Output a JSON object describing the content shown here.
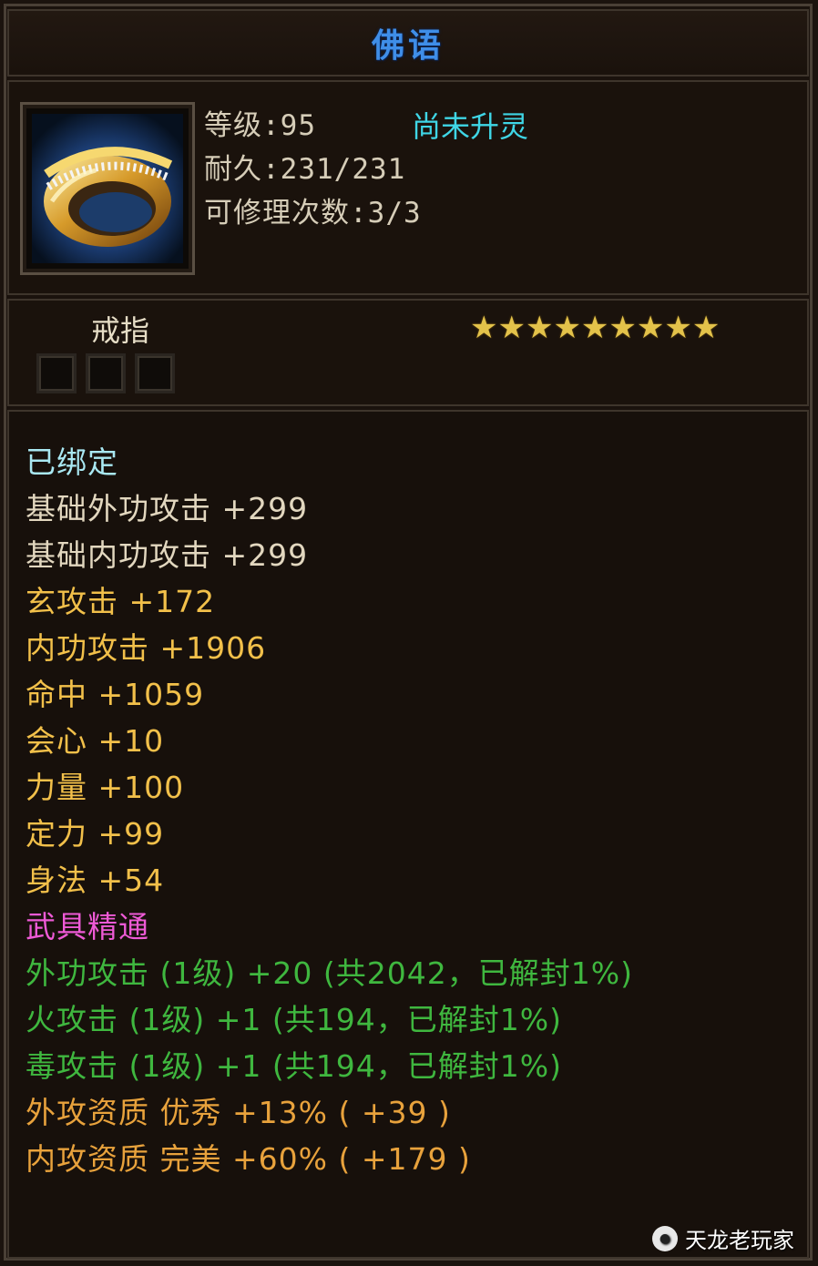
{
  "item": {
    "title": "佛语",
    "level_line": "等级:95",
    "durability_line": "耐久:231/231",
    "repair_line": "可修理次数:3/3",
    "spirit_status": "尚未升灵",
    "type": "戒指",
    "stars_text": "★★★★★★★★★",
    "star_count": 9,
    "socket_count": 3
  },
  "attributes": [
    {
      "text": "已绑定"
    },
    {
      "text": "基础外功攻击 +299"
    },
    {
      "text": "基础内功攻击 +299"
    },
    {
      "text": "玄攻击 +172"
    },
    {
      "text": "内功攻击 +1906"
    },
    {
      "text": "命中 +1059"
    },
    {
      "text": "会心 +10"
    },
    {
      "text": "力量 +100"
    },
    {
      "text": "定力 +99"
    },
    {
      "text": "身法 +54"
    },
    {
      "text": "武具精通"
    },
    {
      "text": "外功攻击 (1级) +20 (共2042，已解封1%)"
    },
    {
      "text": "火攻击 (1级) +1 (共194，已解封1%)"
    },
    {
      "text": "毒攻击 (1级) +1 (共194，已解封1%)"
    },
    {
      "text": "外攻资质  优秀 +13% ( +39 )"
    },
    {
      "text": "内攻资质  完美 +60% ( +179 )"
    }
  ],
  "colors": {
    "title": "#3f8ee8",
    "spirit": "#3fd6e6",
    "bound": "#a9e8f2",
    "base": "#e2d7bf",
    "gold": "#f2c04a",
    "pink": "#ee5ad6",
    "green": "#3fb73f",
    "orange": "#e8a23c",
    "star": "#e3c24a"
  },
  "watermark": {
    "text": "天龙老玩家",
    "icon": "watermark-logo-icon"
  }
}
